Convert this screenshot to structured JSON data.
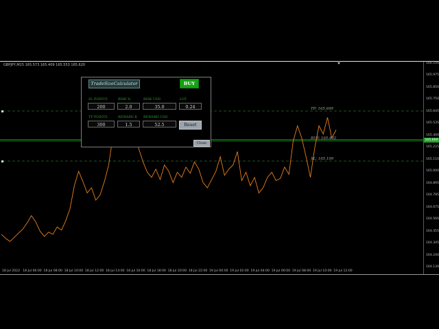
{
  "chart": {
    "symbol_info": "GBPJPY,M15 165.573 165.409 165.553 165.620",
    "scroll_arrow_icon": "triangle-down-icon",
    "current_price": "165.600",
    "price_scale": [
      "166.100",
      "165.975",
      "165.850",
      "165.750",
      "165.645",
      "165.535",
      "165.400",
      "165.225",
      "165.110",
      "165.000",
      "164.895",
      "164.785",
      "164.675",
      "164.560",
      "164.455",
      "164.345",
      "164.240",
      "164.130"
    ],
    "time_axis": [
      "18 Jul 2022",
      "18 Jul 06:00",
      "18 Jul 08:00",
      "18 Jul 10:00",
      "18 Jul 12:00",
      "18 Jul 14:00",
      "18 Jul 16:00",
      "18 Jul 18:00",
      "18 Jul 20:00",
      "18 Jul 22:00",
      "19 Jul 00:00",
      "19 Jul 02:00",
      "19 Jul 04:00",
      "19 Jul 06:00",
      "19 Jul 08:00",
      "19 Jul 10:00",
      "19 Jul 12:00"
    ],
    "levels": {
      "tp": "TP: 165.699",
      "buy": "BUY: 165.402",
      "sl": "SL: 165.199"
    },
    "colors": {
      "price_line": "#e8801c",
      "bid_line": "#1fb41f",
      "ask_line": "#1fb41f"
    }
  },
  "chart_data": {
    "type": "line",
    "series": [
      {
        "values": [
          164.45,
          164.41,
          164.38,
          164.42,
          164.46,
          164.5,
          164.56,
          164.63,
          164.57,
          164.48,
          164.43,
          164.47,
          164.45,
          164.52,
          164.49,
          164.58,
          164.7,
          164.92,
          165.06,
          164.96,
          164.85,
          164.9,
          164.78,
          164.83,
          164.96,
          165.12,
          165.4,
          165.85,
          165.92,
          165.7,
          165.55,
          165.42,
          165.28,
          165.15,
          165.05,
          165.0,
          165.08,
          164.98,
          165.12,
          165.06,
          164.95,
          165.05,
          165.0,
          165.1,
          165.04,
          165.15,
          165.08,
          164.95,
          164.9,
          164.98,
          165.06,
          165.2,
          165.02,
          165.08,
          165.12,
          165.25,
          164.97,
          165.05,
          164.92,
          165.0,
          164.85,
          164.9,
          165.0,
          165.05,
          164.97,
          164.99,
          165.1,
          165.03,
          165.35,
          165.5,
          165.38,
          165.2,
          165.0,
          165.28,
          165.5,
          165.42,
          165.58,
          165.38,
          165.46
        ],
        "color": "#e8801c"
      }
    ],
    "x": [
      "18 Jul 2022",
      "18 Jul 06:00",
      "18 Jul 08:00",
      "18 Jul 10:00",
      "18 Jul 12:00",
      "18 Jul 14:00",
      "18 Jul 16:00",
      "18 Jul 18:00",
      "18 Jul 20:00",
      "18 Jul 22:00",
      "19 Jul 00:00",
      "19 Jul 02:00",
      "19 Jul 04:00",
      "19 Jul 06:00",
      "19 Jul 08:00",
      "19 Jul 10:00",
      "19 Jul 12:00"
    ],
    "ylim": [
      164.13,
      166.1
    ],
    "grid": false,
    "levels": [
      {
        "label": "TP: 165.699",
        "value": 165.699
      },
      {
        "label": "BUY: 165.402",
        "value": 165.402
      },
      {
        "label": "SL: 165.199",
        "value": 165.199
      }
    ]
  },
  "panel": {
    "title": "TradeSizeCalculator",
    "buy_label": "BUY",
    "labels": {
      "sl_points": "SL POINTS",
      "risk_pct": "RISK %",
      "risk_usd": "RISK USD",
      "lot": "LOT",
      "tp_points": "TP POINTS",
      "reward_r": "REWARD R",
      "reward_usd": "REWARD USD"
    },
    "values": {
      "sl_points": "200",
      "risk_pct": "2.0",
      "risk_usd": "35.0",
      "lot": "0.24",
      "tp_points": "300",
      "reward_r": "1.5",
      "reward_usd": "52.5"
    },
    "reset_label": "Reset",
    "close_label": "Close"
  }
}
